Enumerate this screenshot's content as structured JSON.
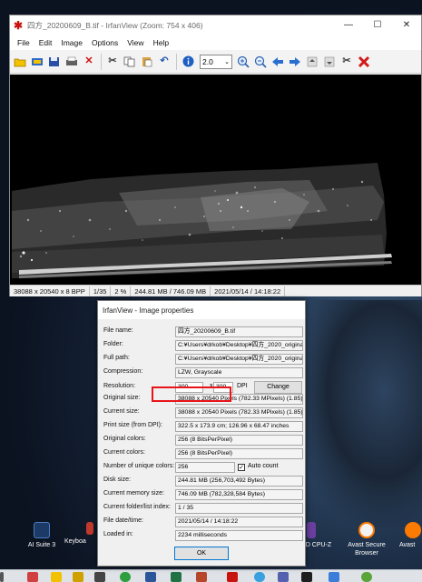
{
  "window": {
    "title": "四方_20200609_B.tif - IrfanView (Zoom: 754 x 406)",
    "app_icon": "✱",
    "minimize": "—",
    "maximize": "☐",
    "close": "✕"
  },
  "menu": [
    "File",
    "Edit",
    "Image",
    "Options",
    "View",
    "Help"
  ],
  "toolbar": {
    "zoom_value": "2.0",
    "icons": [
      "open-icon",
      "slideshow-icon",
      "save-icon",
      "print-icon",
      "delete-icon",
      "cut-icon",
      "copy-icon",
      "paste-icon",
      "undo-icon",
      "info-icon",
      "zoom-in-icon",
      "zoom-out-icon",
      "previous-icon",
      "next-icon",
      "first-icon",
      "last-icon",
      "settings-icon",
      "exit-icon"
    ]
  },
  "status": {
    "dimensions": "38088 x 20540 x 8 BPP",
    "index": "1/35",
    "zoom": "2 %",
    "memory": "244.81 MB / 746.09 MB",
    "date": "2021/05/14 / 14:18:22"
  },
  "dialog": {
    "title": "IrfanView - Image properties",
    "rows": [
      {
        "label": "File name:",
        "value": "四方_20200609_B.tif"
      },
      {
        "label": "Folder:",
        "value": "C:¥Users¥drkob¥Desktop¥四方_2020_original¥"
      },
      {
        "label": "Full path:",
        "value": "C:¥Users¥drkob¥Desktop¥四方_2020_original¥四"
      },
      {
        "label": "Compression:",
        "value": "LZW, Grayscale"
      }
    ],
    "resolution": {
      "label": "Resolution:",
      "x": "300",
      "sep": "x",
      "y": "300",
      "unit": "DPI",
      "change": "Change"
    },
    "rows2": [
      {
        "label": "Original size:",
        "value": "38088 x 20540  Pixels (782.33 MPixels) (1.85)"
      },
      {
        "label": "Current size:",
        "value": "38088 x 20540  Pixels (782.33 MPixels) (1.85)"
      },
      {
        "label": "Print size (from DPI):",
        "value": "322.5 x 173.9 cm; 126.96 x 68.47 inches"
      },
      {
        "label": "Original colors:",
        "value": "256   (8 BitsPerPixel)"
      },
      {
        "label": "Current colors:",
        "value": "256   (8 BitsPerPixel)"
      }
    ],
    "unique": {
      "label": "Number of unique colors:",
      "value": "256",
      "checkbox": "✓",
      "auto_label": "Auto count"
    },
    "rows3": [
      {
        "label": "Disk size:",
        "value": "244.81 MB (256,703,492 Bytes)"
      },
      {
        "label": "Current memory size:",
        "value": "746.09  MB (782,328,584 Bytes)"
      },
      {
        "label": "Current folder/list index:",
        "value": "1  /  35"
      },
      {
        "label": "File date/time:",
        "value": "2021/05/14 / 14:18:22"
      },
      {
        "label": "Loaded in:",
        "value": "2234 milliseconds"
      }
    ],
    "ok": "OK"
  },
  "desktop": {
    "icons": [
      {
        "label": "AI Suite 3"
      },
      {
        "label": "Keyboa"
      },
      {
        "label": "ID CPU-Z"
      },
      {
        "label": "Avast Secure Browser"
      },
      {
        "label": "Avast"
      }
    ]
  }
}
